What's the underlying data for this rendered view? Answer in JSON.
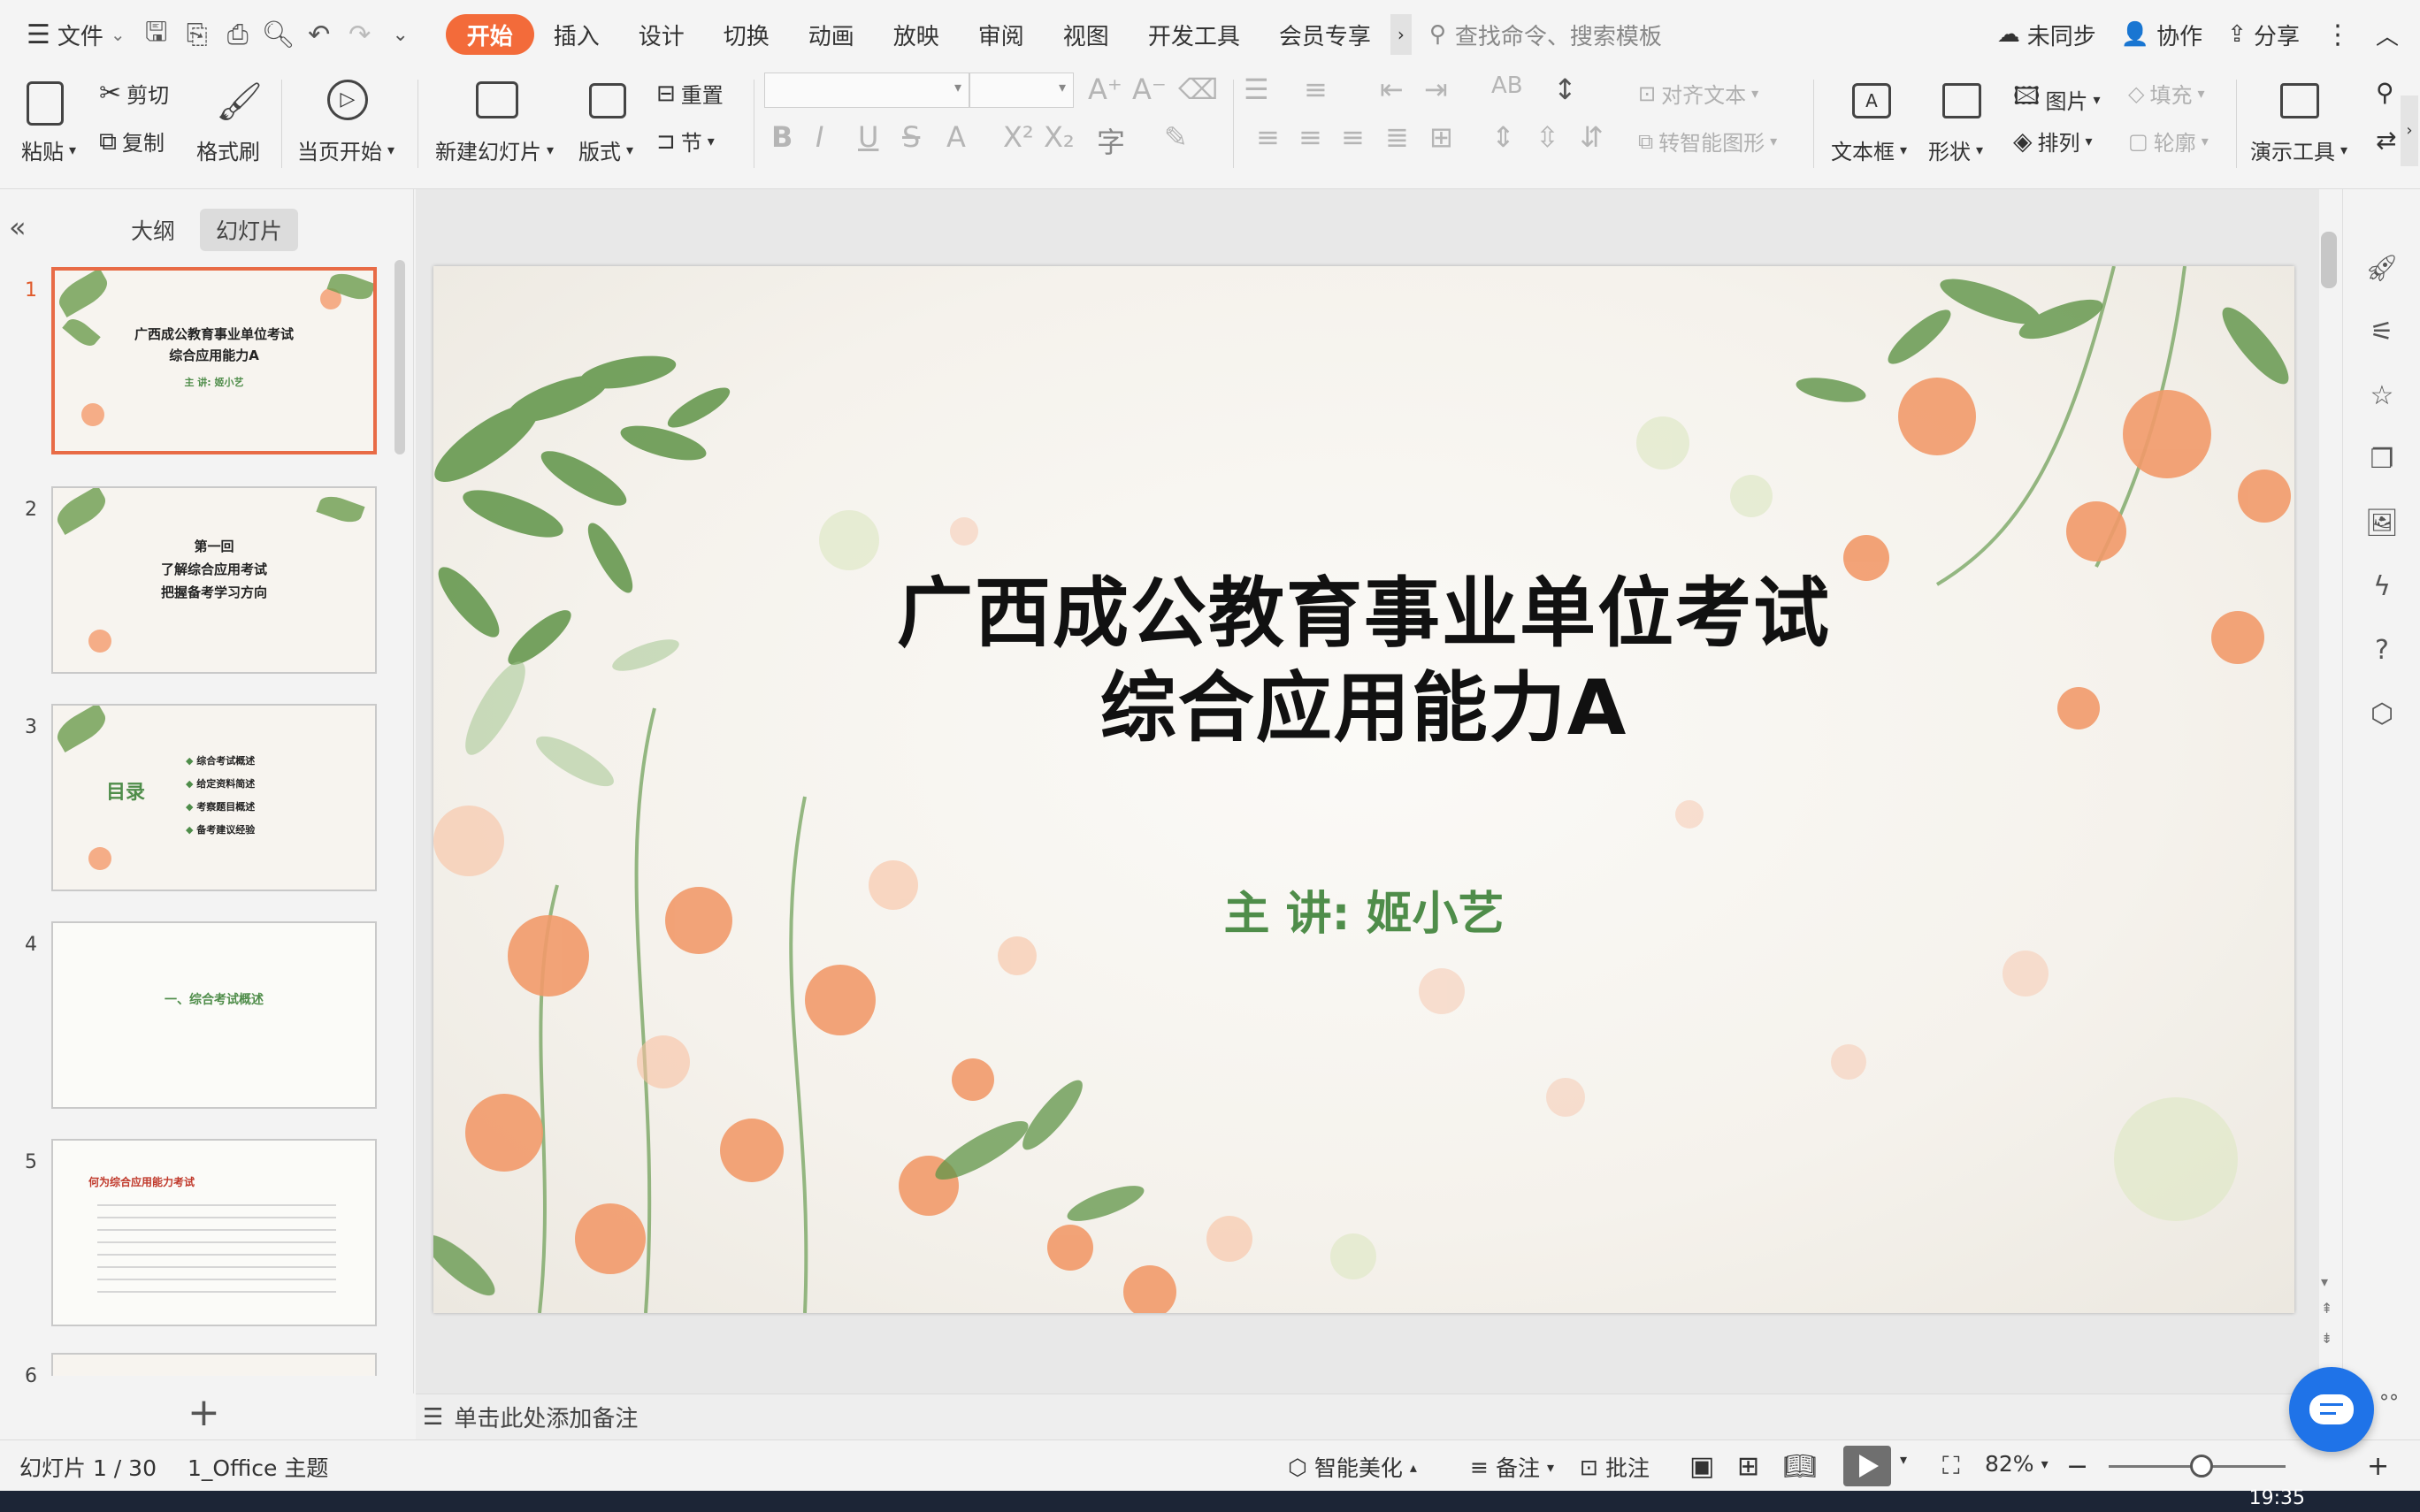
{
  "menubar": {
    "file_label": "文件",
    "tabs": [
      "开始",
      "插入",
      "设计",
      "切换",
      "动画",
      "放映",
      "审阅",
      "视图",
      "开发工具",
      "会员专享"
    ],
    "search_placeholder": "查找命令、搜索模板",
    "sync_label": "未同步",
    "collab_label": "协作",
    "share_label": "分享"
  },
  "ribbon": {
    "paste": "粘贴",
    "cut": "剪切",
    "copy": "复制",
    "format_painter": "格式刷",
    "from_start": "当页开始",
    "new_slide": "新建幻灯片",
    "layout": "版式",
    "reset": "重置",
    "section": "节",
    "align_text": "对齐文本",
    "smart_art": "转智能图形",
    "textbox": "文本框",
    "shape": "形状",
    "picture": "图片",
    "arrange": "排列",
    "fill": "填充",
    "outline": "轮廓",
    "present_tools": "演示工具"
  },
  "leftpanel": {
    "tab_outline": "大纲",
    "tab_slides": "幻灯片",
    "thumbs": [
      {
        "num": "1",
        "line1": "广西成公教育事业单位考试",
        "line2": "综合应用能力A",
        "line3": "主 讲: 姬小艺"
      },
      {
        "num": "2",
        "line1": "第一回",
        "line2": "了解综合应用考试",
        "line3": "把握备考学习方向"
      },
      {
        "num": "3",
        "heading": "目录",
        "items": [
          "综合考试概述",
          "给定资料简述",
          "考察题目概述",
          "备考建议经验"
        ]
      },
      {
        "num": "4",
        "line1": "一、综合考试概述"
      },
      {
        "num": "5",
        "heading": "何为综合应用能力考试"
      },
      {
        "num": "6"
      }
    ]
  },
  "slide": {
    "title_line1": "广西成公教育事业单位考试",
    "title_line2": "综合应用能力A",
    "subtitle": "主 讲: 姬小艺"
  },
  "notes": {
    "placeholder": "单击此处添加备注"
  },
  "status": {
    "slide_counter": "幻灯片 1 / 30",
    "theme": "1_Office 主题",
    "beautify": "智能美化",
    "notes": "备注",
    "comments": "批注",
    "zoom": "82%"
  },
  "taskbar": {
    "time": "19:35"
  },
  "colors": {
    "accent": "#f36b3a",
    "subtitle_green": "#4f8d4a",
    "thumb_active_border": "#e86b46"
  }
}
